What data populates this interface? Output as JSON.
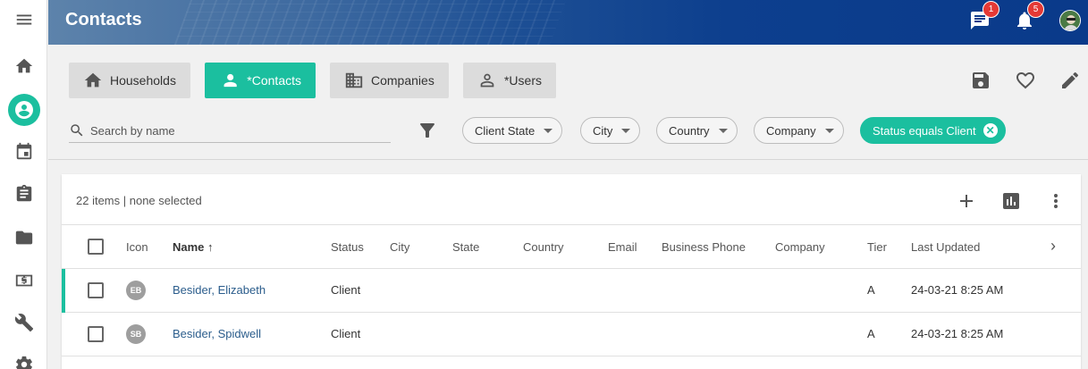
{
  "app": {
    "title": "Contacts"
  },
  "header": {
    "messages_badge": "1",
    "notifications_badge": "5"
  },
  "nav": {
    "items": [
      {
        "icon": "menu-icon"
      },
      {
        "icon": "home-icon"
      },
      {
        "icon": "contacts-icon",
        "active": true
      },
      {
        "icon": "calendar-icon"
      },
      {
        "icon": "clipboard-icon"
      },
      {
        "icon": "folder-icon"
      },
      {
        "icon": "money-icon"
      },
      {
        "icon": "wrench-icon"
      },
      {
        "icon": "gear-icon"
      }
    ]
  },
  "tabs": [
    {
      "label": "Households",
      "icon": "home-icon"
    },
    {
      "label": "*Contacts",
      "icon": "person-icon",
      "active": true
    },
    {
      "label": "Companies",
      "icon": "building-icon"
    },
    {
      "label": "*Users",
      "icon": "person-outline-icon"
    }
  ],
  "search": {
    "placeholder": "Search by name"
  },
  "filters": {
    "chips": [
      "Client State",
      "City",
      "Country",
      "Company"
    ],
    "active": "Status equals Client"
  },
  "grid": {
    "summary": "22 items | none selected",
    "columns": [
      "Icon",
      "Name",
      "Status",
      "City",
      "State",
      "Country",
      "Email",
      "Business Phone",
      "Company",
      "Tier",
      "Last Updated"
    ],
    "rows": [
      {
        "initials": "EB",
        "name": "Besider, Elizabeth",
        "status": "Client",
        "tier": "A",
        "updated": "24-03-21 8:25 AM"
      },
      {
        "initials": "SB",
        "name": "Besider, Spidwell",
        "status": "Client",
        "tier": "A",
        "updated": "24-03-21 8:25 AM"
      }
    ]
  },
  "colors": {
    "accent": "#1bbf9f",
    "header": "#0d3f8e",
    "link": "#2b5d8c",
    "badge": "#e53935"
  }
}
